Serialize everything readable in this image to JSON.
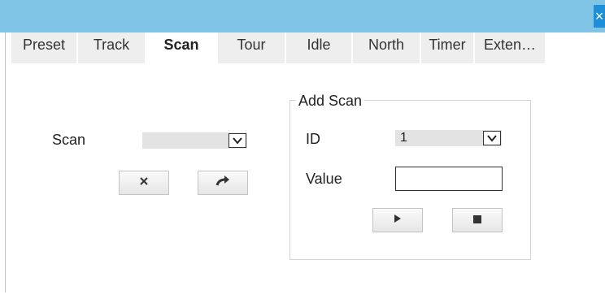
{
  "window": {
    "close_glyph": "×"
  },
  "tabs": [
    {
      "label": "Preset",
      "active": false
    },
    {
      "label": "Track",
      "active": false
    },
    {
      "label": "Scan",
      "active": true
    },
    {
      "label": "Tour",
      "active": false
    },
    {
      "label": "Idle",
      "active": false
    },
    {
      "label": "North",
      "active": false
    },
    {
      "label": "Timer",
      "active": false
    },
    {
      "label": "Exten…",
      "active": false
    }
  ],
  "scan": {
    "label": "Scan",
    "selected_value": "",
    "delete_icon": "close-icon",
    "go_icon": "forward-arrow-icon"
  },
  "add_scan": {
    "legend": "Add Scan",
    "id_label": "ID",
    "id_value": "1",
    "value_label": "Value",
    "value_input": "",
    "start_icon": "play-icon",
    "stop_icon": "stop-icon"
  },
  "colors": {
    "titlebar": "#80c4e6",
    "close_button": "#1e8fd6",
    "tab_inactive": "#eeeeee",
    "select_bg": "#e3e3e3"
  }
}
